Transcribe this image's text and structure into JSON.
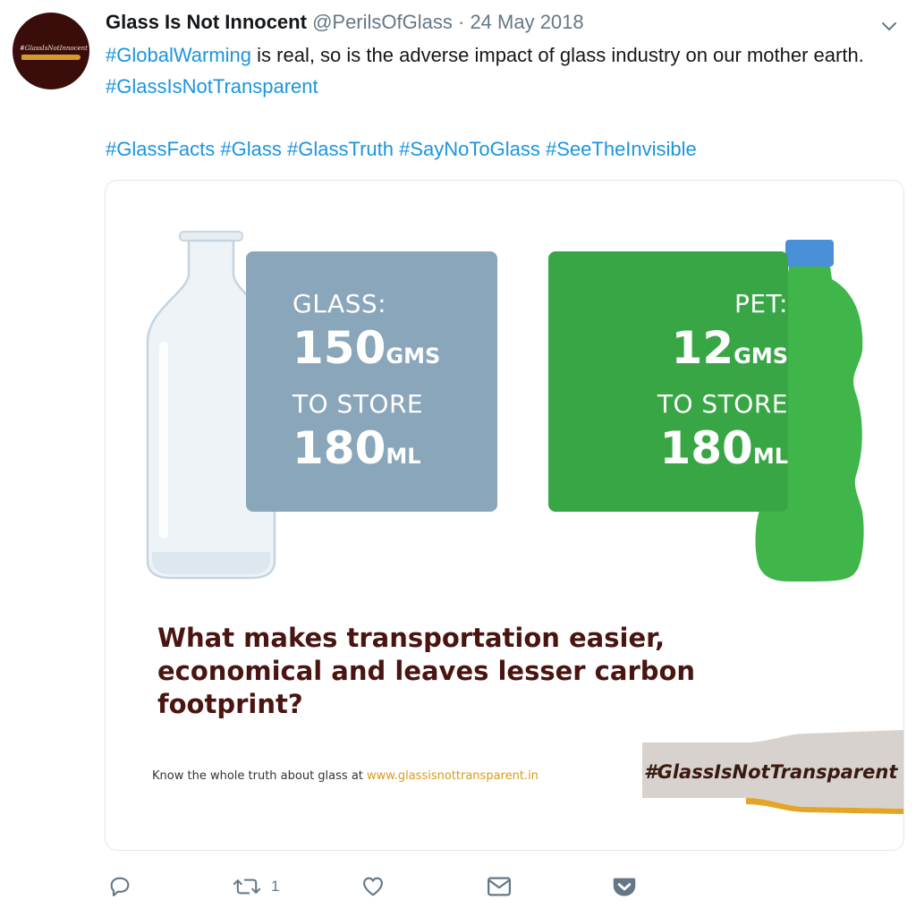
{
  "author": {
    "name": "Glass Is Not Innocent",
    "handle": "@PerilsOfGlass",
    "date": "· 24 May 2018",
    "avatar_text": "#GlassIsNotInnocent"
  },
  "tweet": {
    "line1": [
      {
        "text": "#GlobalWarming",
        "type": "hashtag"
      },
      {
        "text": " is real, so is the adverse impact of glass industry on our mother earth. ",
        "type": "text"
      },
      {
        "text": "#GlassIsNotTransparent",
        "type": "hashtag"
      }
    ],
    "line2": [
      {
        "text": "#GlassFacts",
        "type": "hashtag"
      },
      {
        "text": " ",
        "type": "text"
      },
      {
        "text": "#Glass",
        "type": "hashtag"
      },
      {
        "text": " ",
        "type": "text"
      },
      {
        "text": "#GlassTruth",
        "type": "hashtag"
      },
      {
        "text": " ",
        "type": "text"
      },
      {
        "text": "#SayNoToGlass",
        "type": "hashtag"
      },
      {
        "text": " ",
        "type": "text"
      },
      {
        "text": "#SeeTheInvisible",
        "type": "hashtag"
      }
    ]
  },
  "infographic": {
    "glass": {
      "label": "GLASS:",
      "weight_value": "150",
      "weight_unit": "GMS",
      "store_label": "TO STORE",
      "volume_value": "180",
      "volume_unit": "ML"
    },
    "pet": {
      "label": "PET:",
      "weight_value": "12",
      "weight_unit": "GMS",
      "store_label": "TO STORE",
      "volume_value": "180",
      "volume_unit": "ML"
    },
    "question": "What makes transportation easier, economical and leaves lesser carbon footprint?",
    "footer_text": "Know the whole truth about glass at ",
    "footer_url": "www.glassisnottransparent.in",
    "footer_hashtag": "#GlassIsNotTransparent"
  },
  "actions": {
    "reply_count": "",
    "retweet_count": "1",
    "like_count": ""
  },
  "colors": {
    "hashtag": "#1b95e0",
    "glass_panel": "#8aa6ba",
    "pet_panel": "#39a646",
    "pet_bottle": "#3fb54a",
    "pet_cap": "#4a90d9",
    "question_text": "#4a1510",
    "url_text": "#d89a1c",
    "icon_gray": "#657786"
  }
}
